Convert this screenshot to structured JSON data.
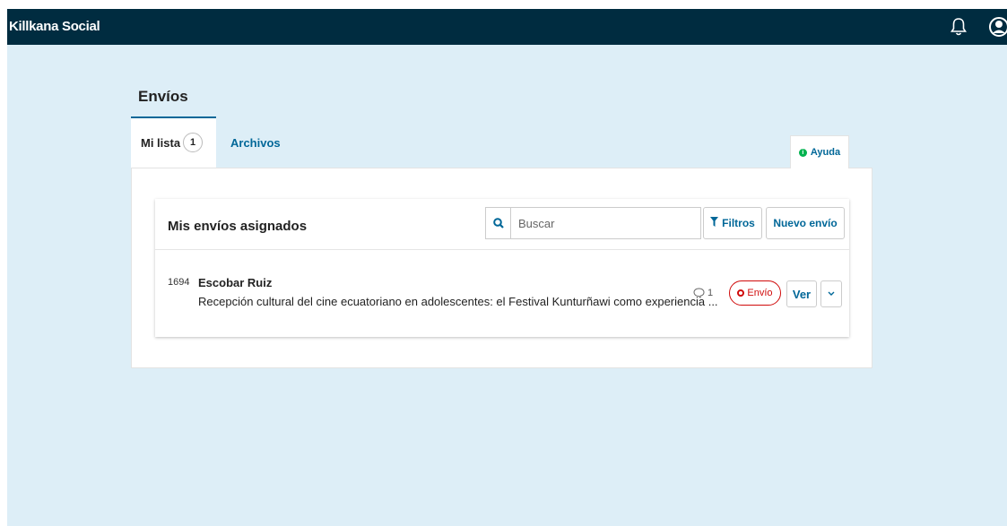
{
  "app": {
    "title": "Killkana Social"
  },
  "page": {
    "title": "Envíos"
  },
  "tabs": [
    {
      "label": "Mi lista",
      "count": "1"
    },
    {
      "label": "Archivos"
    }
  ],
  "help": {
    "label": "Ayuda"
  },
  "list": {
    "title": "Mis envíos asignados",
    "search_placeholder": "Buscar",
    "filter_label": "Filtros",
    "new_label": "Nuevo envío"
  },
  "submissions": [
    {
      "id": "1694",
      "author": "Escobar Ruiz",
      "title": "Recepción cultural del cine ecuatoriano en adolescentes: el Festival Kunturñawi como experiencia ...",
      "comments": "1",
      "stage": "Envío",
      "view_label": "Ver"
    }
  ],
  "colors": {
    "header": "#002c40",
    "background": "#ddeef7",
    "accent": "#006798",
    "stage": "#d00a0a",
    "help_icon": "#00b24e"
  },
  "icons": {
    "notifications": "bell-icon",
    "user": "user-icon",
    "search": "search-icon",
    "filter": "filter-icon",
    "help": "info-icon",
    "comments": "comment-icon",
    "more": "chevron-down-icon"
  }
}
